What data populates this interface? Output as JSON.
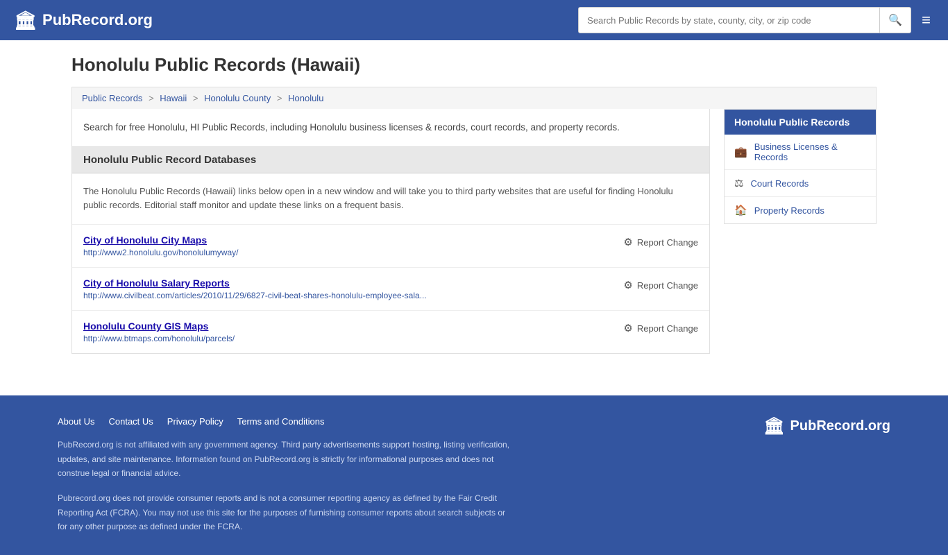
{
  "header": {
    "logo_text": "PubRecord.org",
    "logo_icon": "🏛",
    "search_placeholder": "Search Public Records by state, county, city, or zip code",
    "hamburger_icon": "≡"
  },
  "page": {
    "title": "Honolulu Public Records (Hawaii)"
  },
  "breadcrumb": {
    "items": [
      {
        "label": "Public Records",
        "href": "#"
      },
      {
        "label": "Hawaii",
        "href": "#"
      },
      {
        "label": "Honolulu County",
        "href": "#"
      },
      {
        "label": "Honolulu",
        "href": "#"
      }
    ]
  },
  "description": "Search for free Honolulu, HI Public Records, including Honolulu business licenses & records, court records, and property records.",
  "databases_section": {
    "heading": "Honolulu Public Record Databases",
    "description": "The Honolulu Public Records (Hawaii) links below open in a new window and will take you to third party websites that are useful for finding Honolulu public records. Editorial staff monitor and update these links on a frequent basis."
  },
  "records": [
    {
      "title": "City of Honolulu City Maps",
      "url": "http://www2.honolulu.gov/honolulumyway/",
      "report_label": "Report Change"
    },
    {
      "title": "City of Honolulu Salary Reports",
      "url": "http://www.civilbeat.com/articles/2010/11/29/6827-civil-beat-shares-honolulu-employee-sala...",
      "report_label": "Report Change"
    },
    {
      "title": "Honolulu County GIS Maps",
      "url": "http://www.btmaps.com/honolulu/parcels/",
      "report_label": "Report Change"
    }
  ],
  "sidebar": {
    "title": "Honolulu Public Records",
    "items": [
      {
        "label": "Business Licenses & Records",
        "icon": "💼"
      },
      {
        "label": "Court Records",
        "icon": "⚖"
      },
      {
        "label": "Property Records",
        "icon": "🏠"
      }
    ]
  },
  "footer": {
    "links": [
      {
        "label": "About Us"
      },
      {
        "label": "Contact Us"
      },
      {
        "label": "Privacy Policy"
      },
      {
        "label": "Terms and Conditions"
      }
    ],
    "disclaimer1": "PubRecord.org is not affiliated with any government agency. Third party advertisements support hosting, listing verification, updates, and site maintenance. Information found on PubRecord.org is strictly for informational purposes and does not construe legal or financial advice.",
    "disclaimer2": "Pubrecord.org does not provide consumer reports and is not a consumer reporting agency as defined by the Fair Credit Reporting Act (FCRA). You may not use this site for the purposes of furnishing consumer reports about search subjects or for any other purpose as defined under the FCRA.",
    "logo_text": "PubRecord.org",
    "logo_icon": "🏛"
  }
}
